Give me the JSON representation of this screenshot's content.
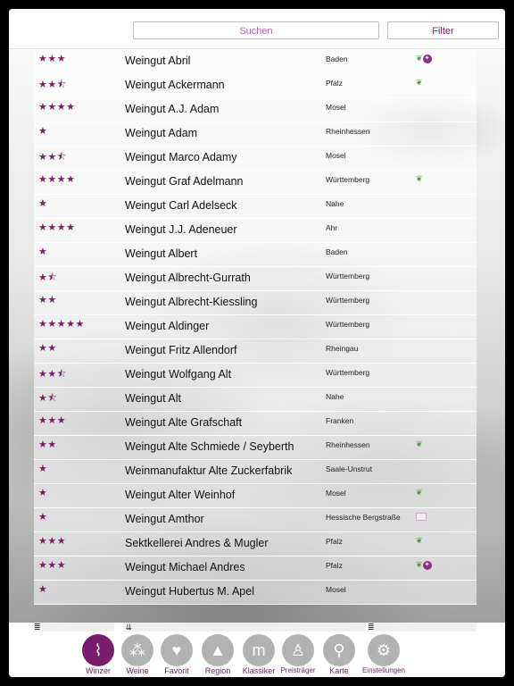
{
  "search": {
    "placeholder": "Suchen"
  },
  "filter_label": "Filter",
  "rows": [
    {
      "stars": "★★★",
      "name": "Weingut Abril",
      "region": "Baden",
      "leaf": true,
      "award": true
    },
    {
      "stars": "★★⯪",
      "name": "Weingut Ackermann",
      "region": "Pfalz",
      "leaf": true
    },
    {
      "stars": "★★★★",
      "name": "Weingut A.J. Adam",
      "region": "Mosel"
    },
    {
      "stars": "★",
      "name": "Weingut Adam",
      "region": "Rheinhessen"
    },
    {
      "stars": "★★⯪",
      "name": "Weingut Marco Adamy",
      "region": "Mosel"
    },
    {
      "stars": "★★★★",
      "name": "Weingut Graf Adelmann",
      "region": "Württemberg",
      "leaf": true
    },
    {
      "stars": "★",
      "name": "Weingut Carl Adelseck",
      "region": "Nahe"
    },
    {
      "stars": "★★★★",
      "name": "Weingut J.J. Adeneuer",
      "region": "Ahr"
    },
    {
      "stars": "★",
      "name": "Weingut Albert",
      "region": "Baden"
    },
    {
      "stars": "★⯪",
      "name": "Weingut Albrecht-Gurrath",
      "region": "Württemberg"
    },
    {
      "stars": "★★",
      "name": "Weingut Albrecht-Kiessling",
      "region": "Württemberg"
    },
    {
      "stars": "★★★★★",
      "name": "Weingut Aldinger",
      "region": "Württemberg"
    },
    {
      "stars": "★★",
      "name": "Weingut Fritz Allendorf",
      "region": "Rheingau"
    },
    {
      "stars": "★★⯪",
      "name": "Weingut Wolfgang Alt",
      "region": "Württemberg"
    },
    {
      "stars": "★⯪",
      "name": "Weingut Alt",
      "region": "Nahe"
    },
    {
      "stars": "★★★",
      "name": "Weingut Alte Grafschaft",
      "region": "Franken"
    },
    {
      "stars": "★★",
      "name": "Weingut Alte Schmiede / Seyberth",
      "region": "Rheinhessen",
      "leaf": true
    },
    {
      "stars": "★",
      "name": "Weinmanufaktur Alte Zuckerfabrik",
      "region": "Saale-Unstrut"
    },
    {
      "stars": "★",
      "name": "Weingut Alter Weinhof",
      "region": "Mosel",
      "leaf": true
    },
    {
      "stars": "★",
      "name": "Weingut Amthor",
      "region": "Hessische Bergstraße",
      "mail": true
    },
    {
      "stars": "★★★",
      "name": "Sektkellerei Andres & Mugler",
      "region": "Pfalz",
      "leaf": true
    },
    {
      "stars": "★★★",
      "name": "Weingut Michael Andres",
      "region": "Pfalz",
      "leaf": true,
      "award": true
    },
    {
      "stars": "★",
      "name": "Weingut Hubertus M. Apel",
      "region": "Mosel"
    }
  ],
  "tabs": [
    {
      "label": "Winzer",
      "icon": "corkscrew-icon",
      "glyph": "⌇",
      "active": true
    },
    {
      "label": "Weine",
      "icon": "grapes-icon",
      "glyph": "⁂"
    },
    {
      "label": "Favorit",
      "icon": "heart-icon",
      "glyph": "♥"
    },
    {
      "label": "Region",
      "icon": "map-region-icon",
      "glyph": "▲"
    },
    {
      "label": "Klassiker",
      "icon": "klassiker-m-icon",
      "glyph": "m"
    },
    {
      "label": "Preisträger",
      "icon": "wine-glass-icon",
      "glyph": "♙"
    },
    {
      "label": "Karte",
      "icon": "map-pin-icon",
      "glyph": "⚲"
    },
    {
      "label": "Einstellungen",
      "icon": "gear-icon",
      "glyph": "⚙"
    }
  ],
  "colors": {
    "accent": "#7a1c6e",
    "leaf": "#4f9a38",
    "tab_inactive": "#b2b2b2"
  }
}
